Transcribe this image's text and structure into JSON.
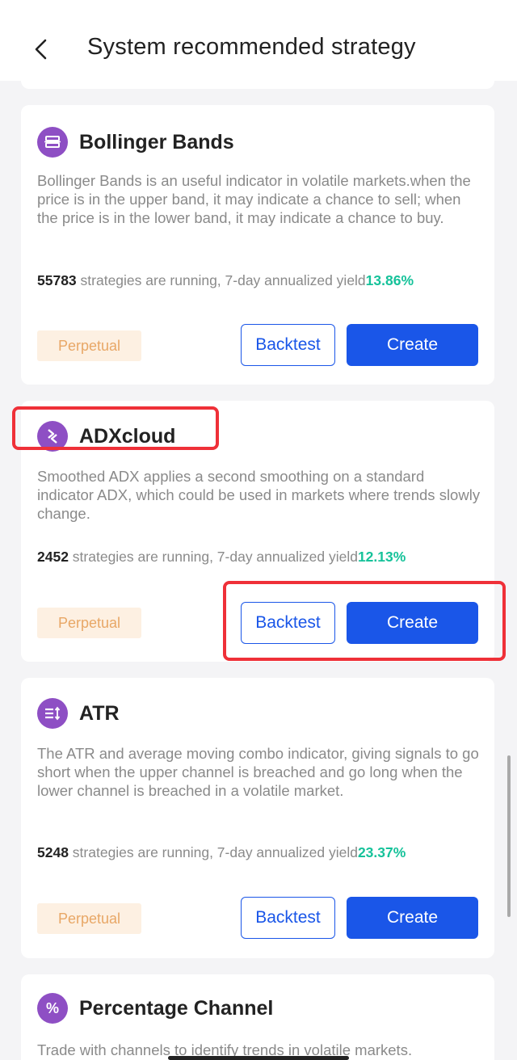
{
  "header": {
    "title": "System recommended strategy"
  },
  "strategies": [
    {
      "name": "Bollinger Bands",
      "icon": "bands-icon",
      "description": "Bollinger Bands is an useful indicator in volatile markets.when the price is in the upper band, it may indicate a chance to  sell; when the price is in the lower band, it may indicate a chance to buy.",
      "count": "55783",
      "running_text": " strategies are running, 7-day annualized yield",
      "yield": "13.86%",
      "tag": "Perpetual",
      "backtest_label": "Backtest",
      "create_label": "Create"
    },
    {
      "name": "ADXcloud",
      "icon": "adx-icon",
      "description": "Smoothed ADX  applies a second smoothing on a standard indicator ADX, which could be  used in markets where trends slowly change.",
      "count": "2452",
      "running_text": " strategies are running, 7-day annualized yield",
      "yield": "12.13%",
      "tag": "Perpetual",
      "backtest_label": "Backtest",
      "create_label": "Create"
    },
    {
      "name": "ATR",
      "icon": "atr-icon",
      "description": "The ATR and average moving combo indicator, giving signals to go short when the upper channel is breached and  go long when the lower channel is breached in a volatile market.",
      "count": "5248",
      "running_text": " strategies are running, 7-day annualized yield",
      "yield": "23.37%",
      "tag": "Perpetual",
      "backtest_label": "Backtest",
      "create_label": "Create"
    },
    {
      "name": "Percentage Channel",
      "icon": "percent-icon",
      "icon_glyph": "%",
      "description": "Trade with channels to identify trends in volatile markets."
    }
  ],
  "colors": {
    "accent": "#1a56e8",
    "yield": "#16c29a",
    "icon_bg": "#8e4fc4",
    "highlight": "#ef3038",
    "tag_bg": "#fdf0e2",
    "tag_text": "#e8a766"
  }
}
